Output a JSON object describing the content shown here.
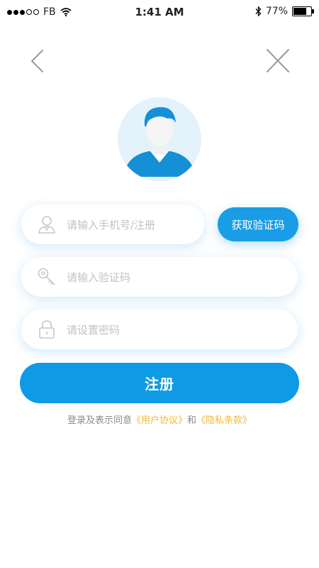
{
  "status_bar": {
    "carrier": "FB",
    "time": "1:41 AM",
    "battery_percent": "77%",
    "battery_level": 0.77,
    "signal_bars": 3,
    "signal_total": 5
  },
  "nav": {
    "back_icon": "chevron-left-icon",
    "close_icon": "close-icon"
  },
  "form": {
    "phone_placeholder": "请输入手机号/注册",
    "code_placeholder": "请输入验证码",
    "password_placeholder": "请设置密码",
    "get_code_label": "获取验证码",
    "register_label": "注册"
  },
  "agreement": {
    "prefix": "登录及表示同意",
    "user_agreement": "《用户协议》",
    "conjunction": "和",
    "privacy_terms": "《隐私条款》"
  },
  "colors": {
    "primary": "#0f9ae6",
    "link": "#f0b73c",
    "placeholder": "#c2c2c2",
    "avatar_bg": "#e4f3fb"
  }
}
